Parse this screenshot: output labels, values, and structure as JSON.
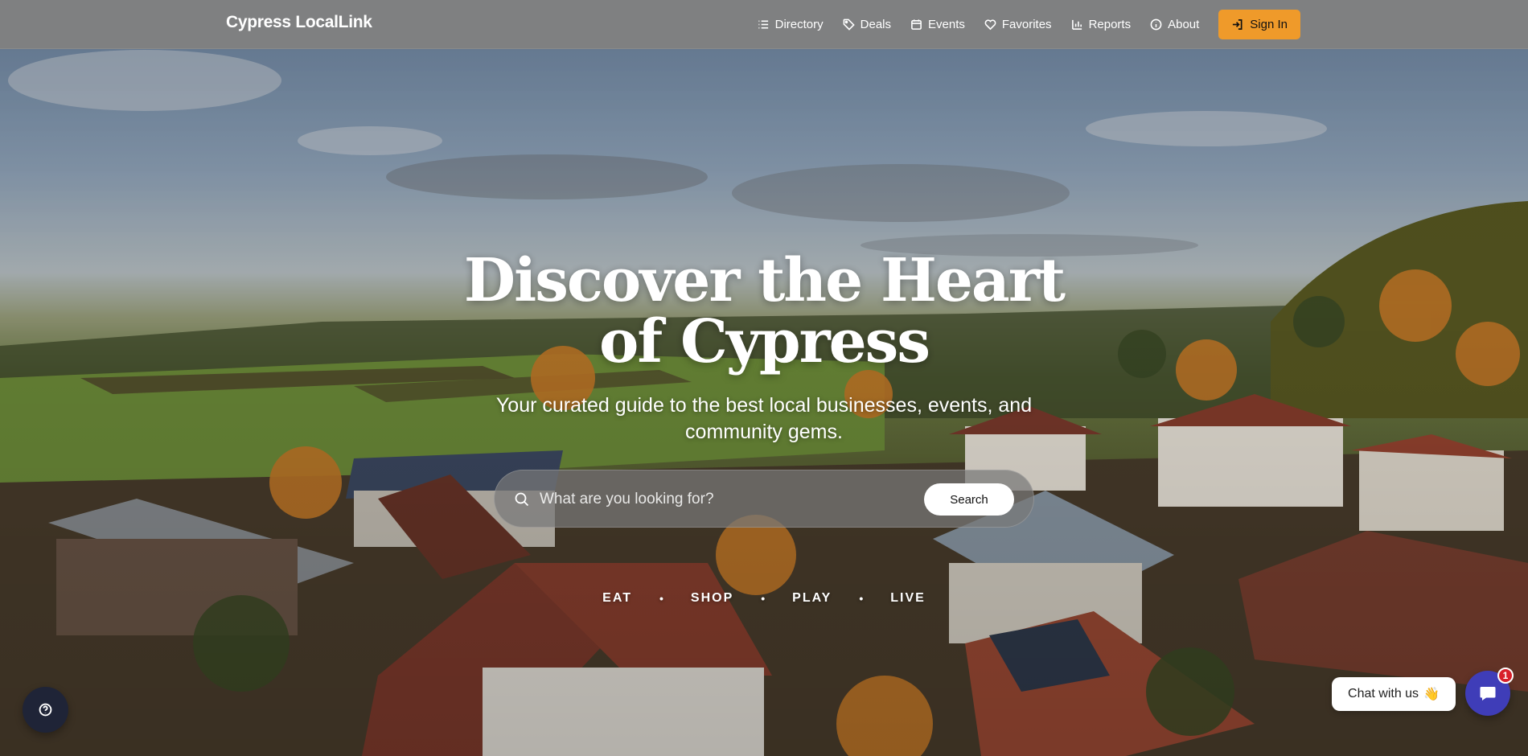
{
  "header": {
    "brand": "Cypress LocalLink",
    "nav": [
      {
        "label": "Directory",
        "icon": "list-icon"
      },
      {
        "label": "Deals",
        "icon": "tag-icon"
      },
      {
        "label": "Events",
        "icon": "calendar-icon"
      },
      {
        "label": "Favorites",
        "icon": "heart-icon"
      },
      {
        "label": "Reports",
        "icon": "bar-chart-icon"
      },
      {
        "label": "About",
        "icon": "info-icon"
      }
    ],
    "sign_in": "Sign In"
  },
  "hero": {
    "title_line1": "Discover the Heart",
    "title_line2": "of Cypress",
    "subtitle": "Your curated guide to the best local businesses, events, and community gems.",
    "search": {
      "placeholder": "What are you looking for?",
      "value": "",
      "button": "Search"
    },
    "tags": [
      "EAT",
      "SHOP",
      "PLAY",
      "LIVE"
    ],
    "separator": "•"
  },
  "widgets": {
    "chat_label": "Chat with us",
    "chat_emoji": "👋",
    "chat_badge_count": "1"
  },
  "colors": {
    "accent": "#ef9a2a",
    "chat": "#3f3db8",
    "help": "#1f2437"
  }
}
